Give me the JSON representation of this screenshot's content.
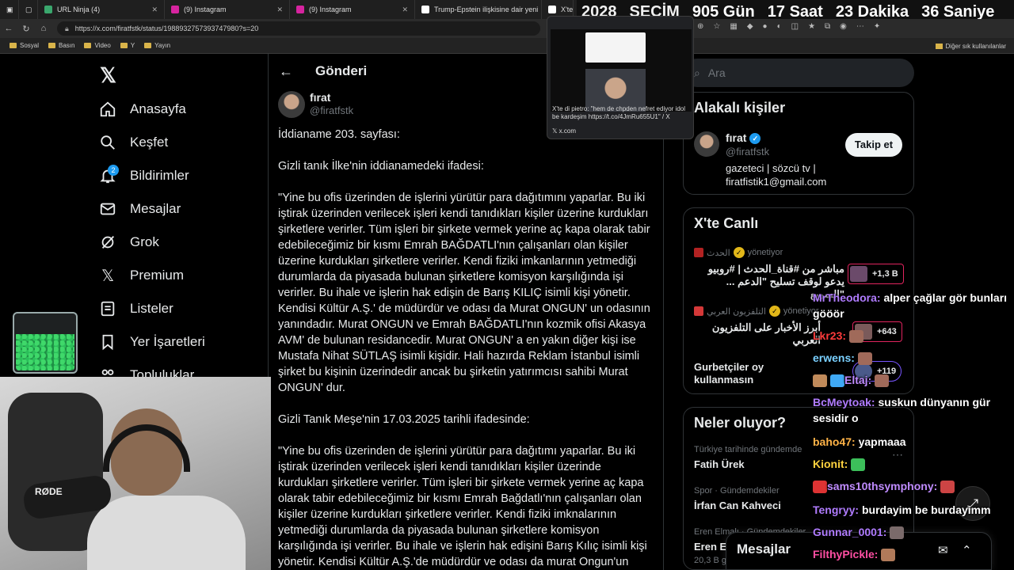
{
  "browser": {
    "tabs": [
      {
        "label": "URL Ninja (4)",
        "color": "#3aa76d"
      },
      {
        "label": "(9) Instagram",
        "color": "#d6249f"
      },
      {
        "label": "(9) Instagram",
        "color": "#d6249f"
      },
      {
        "label": "Trump-Epstein ilişkisine dair yeni",
        "color": "#ffffff"
      },
      {
        "label": "X'te",
        "color": "#ffffff"
      }
    ],
    "url": "https://x.com/firatfstk/status/1988932757393747980?s=20",
    "bookmarks": [
      "Sosyal",
      "Basın",
      "Video",
      "Y",
      "Yayın"
    ],
    "bookmarks_other": "Diğer sık kullanılanlar"
  },
  "countdown": {
    "year": "2028",
    "label": "SEÇİM",
    "days": "905 Gün",
    "hours": "17 Saat",
    "minutes": "23 Dakika",
    "seconds": "36 Saniye"
  },
  "tab_preview": {
    "text": "X'te di pietro: \"hem de chpden nefret ediyor idol be kardeşim https://t.co/4JmRu655U1\" / X",
    "site": "x.com"
  },
  "nav": {
    "items": [
      {
        "label": "Anasayfa",
        "icon": "home-icon"
      },
      {
        "label": "Keşfet",
        "icon": "search-icon"
      },
      {
        "label": "Bildirimler",
        "icon": "bell-icon"
      },
      {
        "label": "Mesajlar",
        "icon": "mail-icon"
      },
      {
        "label": "Grok",
        "icon": "grok-icon"
      },
      {
        "label": "Premium",
        "icon": "x-logo-icon"
      },
      {
        "label": "Listeler",
        "icon": "list-icon"
      },
      {
        "label": "Yer İşaretleri",
        "icon": "bookmark-icon"
      },
      {
        "label": "Topluluklar",
        "icon": "communities-icon"
      }
    ],
    "notification_count": "2"
  },
  "post": {
    "header_title": "Gönderi",
    "author_name": "fırat",
    "author_handle": "@firatfstk",
    "text": "İddianame 203. sayfası:\n\nGizli tanık İlke'nin iddianamedeki ifadesi:\n\n\"Yine bu ofis üzerinden de işlerini yürütür para dağıtımını yaparlar. Bu iki iştirak üzerinden verilecek işleri kendi tanıdıkları kişiler üzerine kurdukları şirketlere verirler. Tüm işleri bir şirkete vermek yerine aç kapa olarak tabir edebileceğimiz bir kısmı Emrah BAĞDATLI'nın çalışanları olan kişiler üzerine kurdukları şirketlere verirler. Kendi fiziki imkanlarının yetmediği durumlarda da piyasada bulunan şirketlere komisyon karşılığında işi verirler. Bu ihale ve işlerin hak edişin de Barış KILIÇ isimli kişi yönetir. Kendisi Kültür A.Ş.' de müdürdür ve odası da Murat ONGUN' un odasının yanındadır. Murat ONGUN ve Emrah BAĞDATLI'nın kozmik ofisi Akasya AVM' de bulunan residancedir. Murat ONGUN' a en yakın diğer kişi ise Mustafa Nihat SÜTLAŞ isimli kişidir. Hali hazırda Reklam İstanbul isimli şirket bu kişinin üzerindedir ancak bu şirketin yatırımcısı sahibi Murat ONGUN' dur.\n\nGizli Tanık Meşe'nin 17.03.2025 tarihli ifadesinde:\n\n\"Yine bu ofis üzerinden de işlerini yürütür para dağıtımı yaparlar. Bu iki iştirak üzerinden verilecek işleri kendi tanıdıkları kişiler üzerinde kurdukları şirketlere verirler. Tüm işleri bir şirkete vermek yerine aç kapa olarak tabir edebileceğimiz bir kısmı Emrah Bağdatlı'nın çalışanları olan kişiler üzerine kurdukları şirketlere verirler. Kendi fiziki imknalarının yetmediği durumlarda da piyasada bulunan şirketlere komisyon karşılığında işi verirler. Bu ihale ve işlerin hak edişini Barış Kılıç isimli kişi yönetir. Kendisi Kültür A.Ş.'de müdürdür ve odası da murat Ongun'un"
  },
  "right": {
    "search_placeholder": "Ara",
    "related": {
      "title": "Alakalı kişiler",
      "name": "fırat",
      "handle": "@firatfstk",
      "bio": "gazeteci | sözcü tv |\nfiratfistik1@gmail.com",
      "follow_label": "Takip et"
    },
    "live": {
      "title": "X'te Canlı",
      "items": [
        {
          "source": "الحدث",
          "role": "yönetiyor",
          "title": "مباشر من #قناة_الحدث | #روبيو\n... يدعو لوقف تسليح \"الدعم السريع\"",
          "listeners": "+1,3 B"
        },
        {
          "source": "التلفزيون العربي",
          "role": "yönetiyor",
          "title": "أبرز الأخبار على التلفزيون العربي",
          "listeners": "+643"
        },
        {
          "source": "",
          "role": "",
          "title": "Gurbetçiler oy\nkullanmasın",
          "listeners": "+119"
        }
      ]
    },
    "trends": {
      "title": "Neler oluyor?",
      "items": [
        {
          "category": "Türkiye tarihinde gündemde",
          "name": "Fatih Ürek"
        },
        {
          "category": "Spor · Gündemdekiler",
          "name": "İrfan Can Kahveci"
        },
        {
          "category": "Eren Elmalı · Gündemdekiler",
          "name": "Eren El"
        }
      ],
      "footer_count": "20,3 B g"
    },
    "messages_title": "Mesajlar"
  },
  "chat": [
    {
      "user": "MrTheodora:",
      "color": "#b07cff",
      "msg": "alper çağlar gör bunları gööör"
    },
    {
      "user": "Lkr23:",
      "color": "#ff3b3b",
      "msg": ""
    },
    {
      "user": "erwens:",
      "color": "#7ad0ff",
      "msg": ""
    },
    {
      "user": "Eltaj:",
      "color": "#c08cff",
      "msg": ""
    },
    {
      "user": "BcMeytoak:",
      "color": "#b07cff",
      "msg": "suskun dünyanın gür sesidir o"
    },
    {
      "user": "baho47:",
      "color": "#ffb347",
      "msg": "yapmaaa"
    },
    {
      "user": "Kionit:",
      "color": "#ffd23f",
      "msg": ""
    },
    {
      "user": "sams10thsymphony:",
      "color": "#c08cff",
      "msg": ""
    },
    {
      "user": "Tengryy:",
      "color": "#b07cff",
      "msg": "burdayim be burdayimm"
    },
    {
      "user": "Gunnar_0001:",
      "color": "#b07cff",
      "msg": ""
    },
    {
      "user": "FilthyPickle:",
      "color": "#ff4fa3",
      "msg": ""
    }
  ],
  "colors": {
    "accent": "#1d9bf0",
    "live_border": "#e0245e",
    "background": "#000000"
  }
}
